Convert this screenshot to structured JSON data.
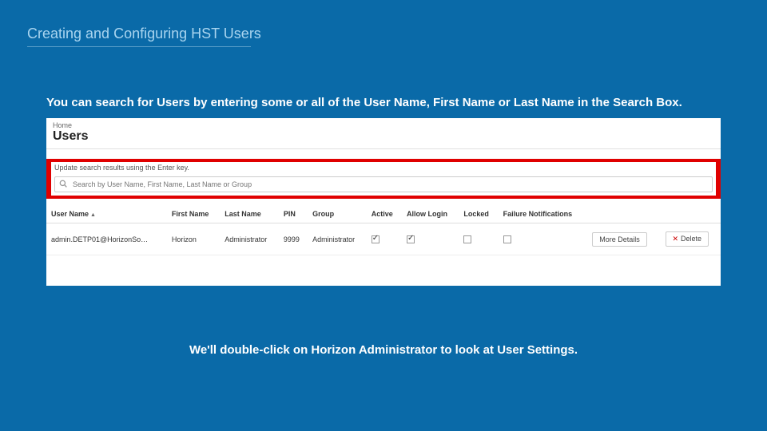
{
  "slide": {
    "title": "Creating and Configuring HST Users",
    "instruction": "You can search for Users by entering some or all of the User Name, First Name or Last Name in the Search Box.",
    "caption": "We'll double-click on Horizon Administrator to look at User Settings."
  },
  "panel": {
    "breadcrumb": "Home",
    "title": "Users",
    "add_icon_label": "+",
    "search_hint": "Update search results using the Enter key.",
    "search_placeholder": "Search by User Name, First Name, Last Name or Group",
    "columns": {
      "user_name": "User Name",
      "first_name": "First Name",
      "last_name": "Last Name",
      "pin": "PIN",
      "group": "Group",
      "active": "Active",
      "allow_login": "Allow Login",
      "locked": "Locked",
      "failure": "Failure Notifications"
    },
    "row": {
      "user_name": "admin.DETP01@HorizonSo…",
      "first_name": "Horizon",
      "last_name": "Administrator",
      "pin": "9999",
      "group": "Administrator",
      "active_checked": "true",
      "allow_login_checked": "true",
      "locked_checked": "false",
      "failure_checked": "false",
      "more": "More Details",
      "delete": "Delete"
    }
  }
}
